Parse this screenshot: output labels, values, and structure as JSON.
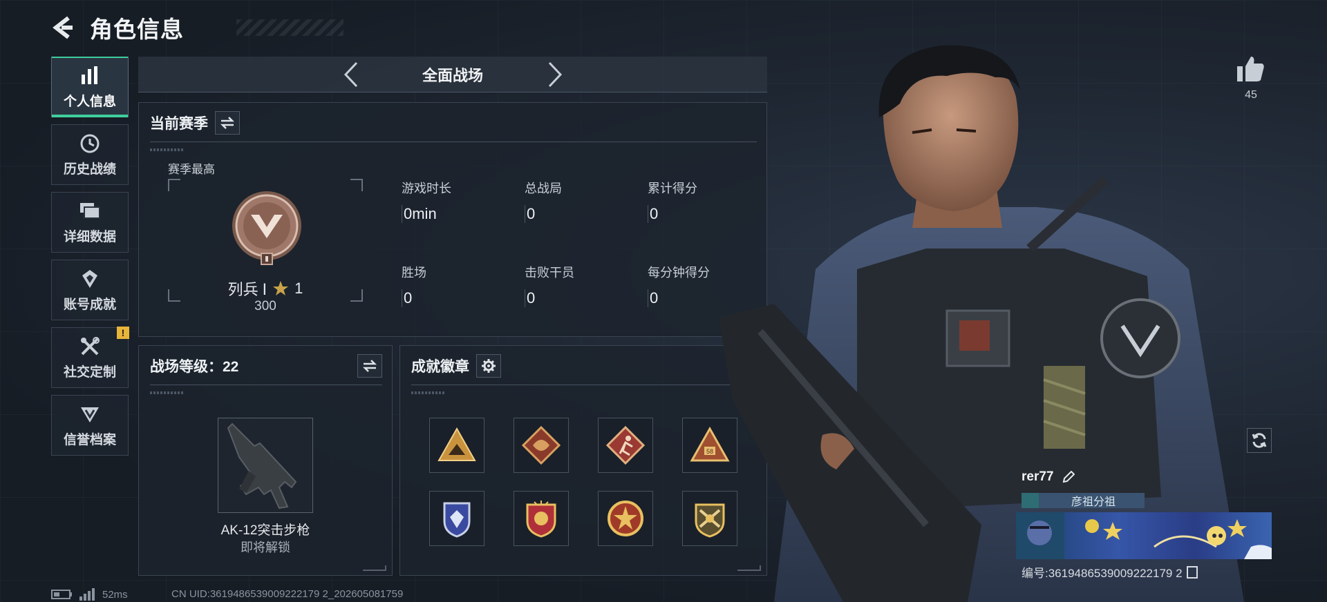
{
  "header": {
    "title": "角色信息"
  },
  "nav": {
    "items": [
      {
        "label": "个人信息",
        "active": true,
        "icon": "bar-chart-icon"
      },
      {
        "label": "历史战绩",
        "active": false,
        "icon": "history-icon"
      },
      {
        "label": "详细数据",
        "active": false,
        "icon": "folders-icon"
      },
      {
        "label": "账号成就",
        "active": false,
        "icon": "medal-icon"
      },
      {
        "label": "社交定制",
        "active": false,
        "icon": "tools-icon",
        "badge": "!"
      },
      {
        "label": "信誉档案",
        "active": false,
        "icon": "credit-icon"
      }
    ]
  },
  "mode": {
    "title": "全面战场"
  },
  "season": {
    "title": "当前赛季",
    "best_label": "赛季最高",
    "rank_name": "列兵 Ⅰ",
    "rank_stars": "1",
    "rank_score": "300",
    "stats": [
      {
        "label": "游戏时长",
        "value": "0min"
      },
      {
        "label": "总战局",
        "value": "0"
      },
      {
        "label": "累计得分",
        "value": "0"
      },
      {
        "label": "胜场",
        "value": "0"
      },
      {
        "label": "击败干员",
        "value": "0"
      },
      {
        "label": "每分钟得分",
        "value": "0"
      }
    ]
  },
  "battlefield_level": {
    "title": "战场等级：22",
    "weapon_name": "AK-12突击步枪",
    "weapon_status": "即将解锁"
  },
  "achievements": {
    "title": "成就徽章",
    "badges": [
      "triangle-squad-badge",
      "dragon-diamond-badge",
      "runner-diamond-badge",
      "triangle-58-badge",
      "blue-shield-badge",
      "gold-shield-badge",
      "star-medal-badge",
      "crossed-guns-badge"
    ]
  },
  "player": {
    "likes": "45",
    "name": "rer77",
    "guild": "彦祖分祖",
    "id_text": "编号:3619486539009222179 2"
  },
  "footer": {
    "ping": "52ms",
    "uid": "CN UID:3619486539009222179 2_202605081759"
  },
  "colors": {
    "accent": "#3fcf9d",
    "badge_gold": "#c9933e",
    "background": "#1a2029"
  }
}
